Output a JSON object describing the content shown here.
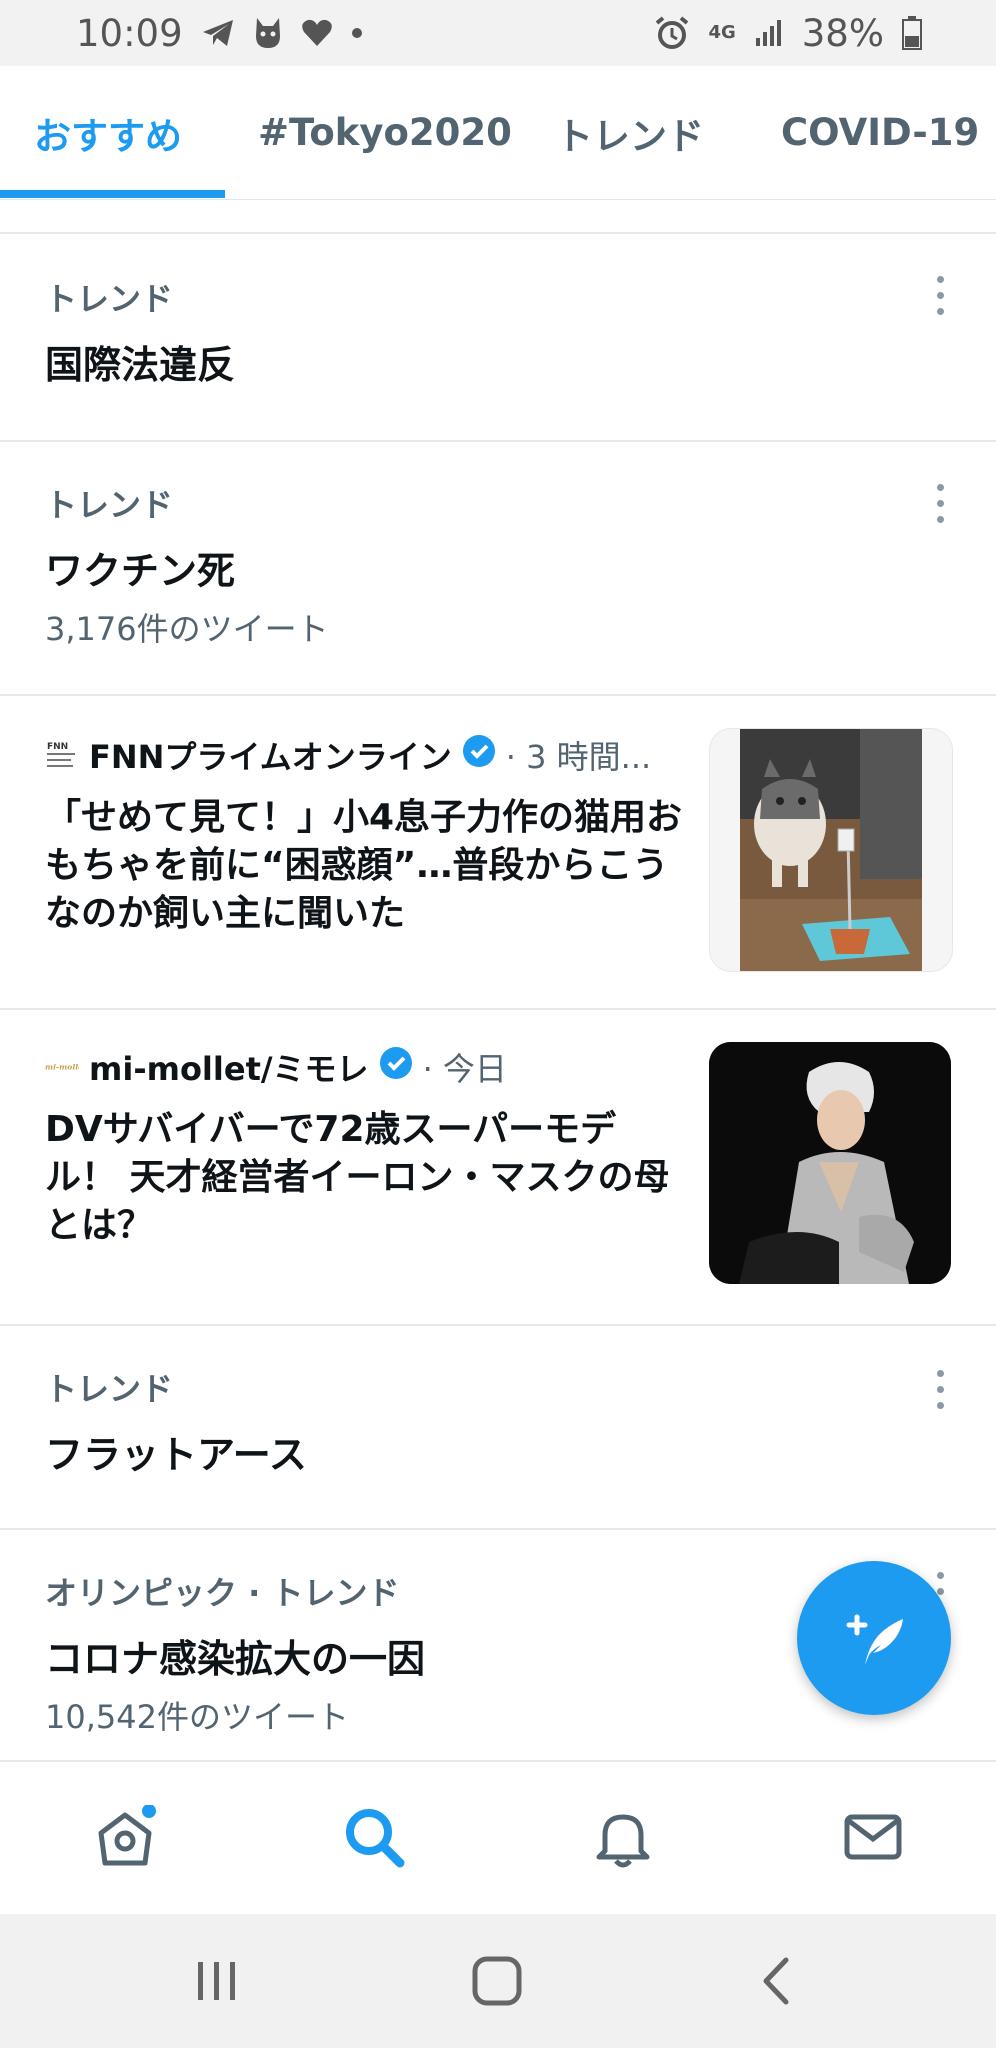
{
  "status_bar": {
    "time": "10:09",
    "network": "4G",
    "battery": "38%"
  },
  "tabs": [
    {
      "label": "おすすめ",
      "active": true
    },
    {
      "label": "#Tokyo2020",
      "active": false
    },
    {
      "label": "トレンド",
      "active": false
    },
    {
      "label": "COVID-19",
      "active": false
    }
  ],
  "trend1": {
    "label": "トレンド",
    "title": "国際法違反"
  },
  "trend2": {
    "label": "トレンド",
    "title": "ワクチン死",
    "count": "3,176件のツイート"
  },
  "news1": {
    "source": "FNNプライムオンライン",
    "time": "· 3 時間...",
    "title": "「せめて見て！」小4息子力作の猫用おもちゃを前に“困惑顔”…普段からこうなのか飼い主に聞いた",
    "logo_text": "FNN"
  },
  "news2": {
    "source": "mi-mollet/ミモレ",
    "time": "· 今日",
    "title": "DVサバイバーで72歳スーパーモデル！ 天才経営者イーロン・マスクの母とは？",
    "logo_text": "mi-mollet"
  },
  "trend3": {
    "label": "トレンド",
    "title": "フラットアース"
  },
  "trend4": {
    "label": "オリンピック · トレンド",
    "title": "コロナ感染拡大の一因",
    "count": "10,542件のツイート"
  },
  "nav": {
    "items": [
      "home-icon",
      "search-icon",
      "notifications-icon",
      "messages-icon"
    ],
    "active": "search-icon"
  },
  "colors": {
    "accent": "#1d9bf0",
    "secondary_text": "#536471"
  }
}
